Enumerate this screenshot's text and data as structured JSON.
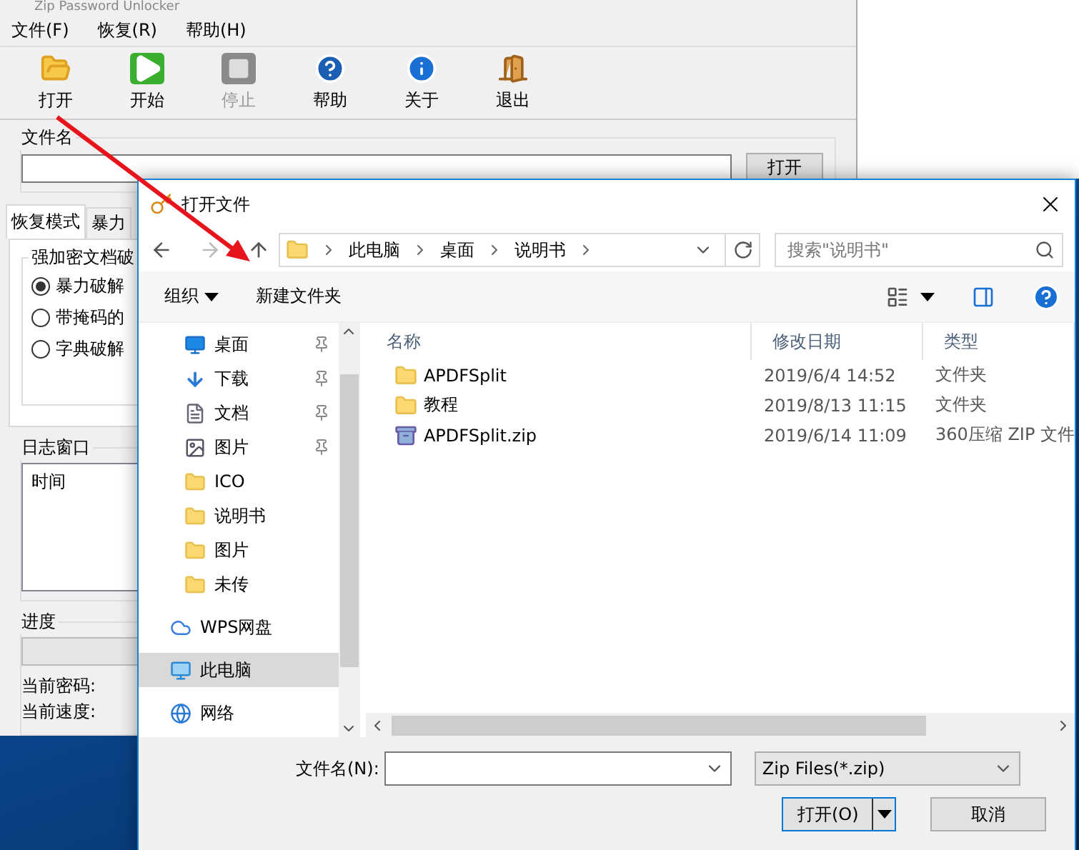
{
  "app": {
    "title": "Zip Password Unlocker",
    "menu": [
      "文件(F)",
      "恢复(R)",
      "帮助(H)"
    ],
    "toolbar": [
      {
        "kind": "open",
        "label": "打开",
        "disabled": false
      },
      {
        "kind": "start",
        "label": "开始",
        "disabled": false
      },
      {
        "kind": "stop",
        "label": "停止",
        "disabled": true
      },
      {
        "kind": "help",
        "label": "帮助",
        "disabled": false
      },
      {
        "kind": "about",
        "label": "关于",
        "disabled": false
      },
      {
        "kind": "exit",
        "label": "退出",
        "disabled": false
      }
    ],
    "file_group": {
      "title": "文件名",
      "button": "打开"
    },
    "tabs": [
      {
        "label": "恢复模式",
        "selected": true
      },
      {
        "label": "暴力",
        "selected": false
      }
    ],
    "mode_group": {
      "title": "强加密文档破",
      "options": [
        {
          "label": "暴力破解",
          "selected": true
        },
        {
          "label": "带掩码的",
          "selected": false
        },
        {
          "label": "字典破解",
          "selected": false
        }
      ]
    },
    "log": {
      "title": "日志窗口",
      "columns": [
        "时间"
      ]
    },
    "progress": {
      "title": "进度",
      "level": 0,
      "labels": [
        "当前密码:",
        "当前速度:"
      ]
    }
  },
  "dialog": {
    "title": "打开文件",
    "path": [
      "此电脑",
      "桌面",
      "说明书"
    ],
    "search": {
      "placeholder": "搜索\"说明书\""
    },
    "commands": [
      "组织",
      "新建文件夹"
    ],
    "nav": [
      {
        "kind": "desktop",
        "label": "桌面",
        "pinned": true,
        "selected": false
      },
      {
        "kind": "download",
        "label": "下载",
        "pinned": true,
        "selected": false
      },
      {
        "kind": "document",
        "label": "文档",
        "pinned": true,
        "selected": false
      },
      {
        "kind": "picture",
        "label": "图片",
        "pinned": true,
        "selected": false
      },
      {
        "kind": "folder",
        "label": "ICO",
        "pinned": false,
        "selected": false
      },
      {
        "kind": "folder",
        "label": "说明书",
        "pinned": false,
        "selected": false
      },
      {
        "kind": "folder",
        "label": "图片",
        "pinned": false,
        "selected": false
      },
      {
        "kind": "folder",
        "label": "未传",
        "pinned": false,
        "selected": false
      },
      {
        "kind": "cloud",
        "label": "WPS网盘",
        "pinned": false,
        "selected": false
      },
      {
        "kind": "computer",
        "label": "此电脑",
        "pinned": false,
        "selected": true
      },
      {
        "kind": "network",
        "label": "网络",
        "pinned": false,
        "selected": false
      }
    ],
    "columns": [
      "名称",
      "修改日期",
      "类型"
    ],
    "files": [
      {
        "kind": "folder",
        "name": "APDFSplit",
        "date": "2019/6/4 14:52",
        "type": "文件夹"
      },
      {
        "kind": "folder",
        "name": "教程",
        "date": "2019/8/13 11:15",
        "type": "文件夹"
      },
      {
        "kind": "archive",
        "name": "APDFSplit.zip",
        "date": "2019/6/14 11:09",
        "type": "360压缩 ZIP 文件"
      }
    ],
    "filename": {
      "label": "文件名(N):"
    },
    "filter": "Zip Files(*.zip)",
    "buttons": {
      "open": "打开(O)",
      "cancel": "取消"
    }
  }
}
